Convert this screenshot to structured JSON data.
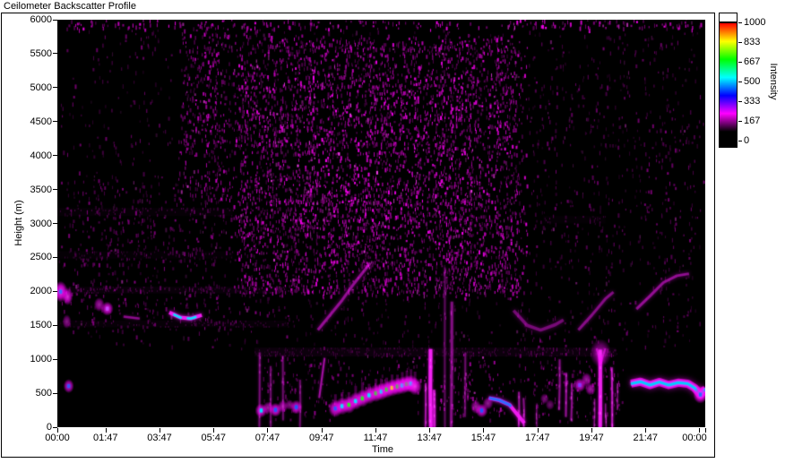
{
  "window": {
    "title": "Ceilometer Backscatter Profile"
  },
  "chart_data": {
    "type": "heatmap",
    "title": "Ceilometer Backscatter Profile",
    "xlabel": "Time",
    "ylabel": "Height (m)",
    "colorbar_label": "Intensity",
    "x_range_hours": [
      0,
      24
    ],
    "y_range_m": [
      0,
      6000
    ],
    "intensity_range": [
      0,
      1000
    ],
    "x_ticks": [
      [
        0,
        "00:00"
      ],
      [
        1.7833,
        "01:47"
      ],
      [
        3.7833,
        "03:47"
      ],
      [
        5.7833,
        "05:47"
      ],
      [
        7.7833,
        "07:47"
      ],
      [
        9.7833,
        "09:47"
      ],
      [
        11.7833,
        "11:47"
      ],
      [
        13.7833,
        "13:47"
      ],
      [
        15.7833,
        "15:47"
      ],
      [
        17.7833,
        "17:47"
      ],
      [
        19.7833,
        "19:47"
      ],
      [
        21.7833,
        "21:47"
      ],
      [
        23.7833,
        ""
      ],
      [
        24,
        "00:00"
      ]
    ],
    "y_tick_values": [
      0,
      500,
      1000,
      1500,
      2000,
      2500,
      3000,
      3500,
      4000,
      4500,
      5000,
      5500,
      6000
    ],
    "colorbar_ticks": [
      [
        1000,
        "1000"
      ],
      [
        833,
        "833"
      ],
      [
        667,
        "667"
      ],
      [
        500,
        "500"
      ],
      [
        333,
        "333"
      ],
      [
        167,
        "167"
      ],
      [
        0,
        "0"
      ]
    ],
    "colormap_stops": [
      [
        0.0,
        "#000000"
      ],
      [
        0.167,
        "#ff00ff"
      ],
      [
        0.333,
        "#0000ff"
      ],
      [
        0.5,
        "#00ffff"
      ],
      [
        0.667,
        "#00ff00"
      ],
      [
        0.833,
        "#ffff00"
      ],
      [
        1.0,
        "#ff0000"
      ]
    ],
    "over_range_color": "#ffffff",
    "background_color": "#000000",
    "speckle_color": "#ff00ff",
    "noise_regions": [
      [
        0,
        24,
        1150,
        6000,
        0.05,
        0.15,
        0.45
      ],
      [
        0,
        6.5,
        2300,
        3600,
        0.12,
        0.2,
        0.5
      ],
      [
        4.3,
        8,
        3300,
        6000,
        0.22,
        0.25,
        0.8
      ],
      [
        6.3,
        17.5,
        1900,
        5800,
        0.3,
        0.25,
        0.9
      ],
      [
        8.3,
        15.8,
        2600,
        5300,
        0.32,
        0.3,
        1.0
      ],
      [
        0,
        8.5,
        1400,
        2250,
        0.1,
        0.2,
        0.55
      ],
      [
        17.5,
        24,
        2300,
        5600,
        0.07,
        0.15,
        0.45
      ],
      [
        21.3,
        24,
        2800,
        4800,
        0.09,
        0.2,
        0.5
      ],
      [
        7.3,
        14,
        100,
        1150,
        0.1,
        0.2,
        0.6
      ],
      [
        13.9,
        16.6,
        100,
        1150,
        0.13,
        0.25,
        0.7
      ],
      [
        16.6,
        21,
        100,
        1450,
        0.1,
        0.2,
        0.6
      ],
      [
        0,
        24,
        5870,
        6000,
        0.6,
        0.35,
        1.0
      ]
    ],
    "bands": [
      [
        0,
        8.5,
        1970,
        2070,
        0.1
      ],
      [
        0,
        8.5,
        1470,
        1570,
        0.08
      ],
      [
        7.3,
        20.7,
        1040,
        1170,
        0.14
      ],
      [
        0,
        6.5,
        3110,
        3230,
        0.07
      ],
      [
        0,
        6.5,
        2480,
        2590,
        0.06
      ],
      [
        18,
        20.3,
        3000,
        3110,
        0.06
      ]
    ],
    "vertical_streaks": [
      [
        7.5,
        0,
        1100,
        2,
        0.35
      ],
      [
        7.9,
        0,
        900,
        2,
        0.3
      ],
      [
        8.35,
        100,
        1050,
        2,
        0.3
      ],
      [
        9.0,
        0,
        700,
        2,
        0.3
      ],
      [
        13.65,
        0,
        650,
        2,
        0.5
      ],
      [
        13.82,
        0,
        1150,
        4,
        0.85
      ],
      [
        13.97,
        0,
        550,
        3,
        0.6
      ],
      [
        14.35,
        0,
        2350,
        2,
        0.25
      ],
      [
        14.6,
        0,
        1850,
        3,
        0.35
      ],
      [
        15.1,
        150,
        1100,
        2,
        0.3
      ],
      [
        17.1,
        0,
        520,
        2,
        0.45
      ],
      [
        17.28,
        0,
        430,
        2,
        0.4
      ],
      [
        17.75,
        0,
        350,
        1.5,
        0.3
      ],
      [
        18.6,
        250,
        1000,
        2,
        0.4
      ],
      [
        18.85,
        150,
        800,
        2,
        0.45
      ],
      [
        19.05,
        100,
        650,
        2,
        0.4
      ],
      [
        19.9,
        0,
        420,
        1.5,
        0.4
      ],
      [
        20.12,
        0,
        1140,
        4,
        0.8
      ],
      [
        20.32,
        0,
        350,
        1.5,
        0.4
      ],
      [
        20.55,
        0,
        880,
        2,
        0.6
      ],
      [
        20.75,
        250,
        650,
        1.5,
        0.35
      ]
    ],
    "traces": [
      {
        "p": [
          [
            4.15,
            1690
          ],
          [
            4.55,
            1615
          ],
          [
            4.95,
            1600
          ],
          [
            5.35,
            1650
          ]
        ],
        "w": 4,
        "a": 0.9,
        "blur": 4,
        "core": {
          "c": "#00e8ff",
          "w": 2,
          "s": [
            [
              4.3,
              4.6
            ],
            [
              4.8,
              5.15
            ]
          ]
        }
      },
      {
        "p": [
          [
            2.45,
            1630
          ],
          [
            3.05,
            1600
          ]
        ],
        "w": 2.5,
        "a": 0.4,
        "blur": 3
      },
      {
        "p": [
          [
            9.65,
            1430
          ],
          [
            10.55,
            1870
          ],
          [
            11.0,
            2120
          ],
          [
            11.6,
            2420
          ]
        ],
        "w": 3,
        "a": 0.45,
        "blur": 4
      },
      {
        "p": [
          [
            9.7,
            430
          ],
          [
            9.9,
            1020
          ]
        ],
        "w": 2,
        "a": 0.5,
        "blur": 3
      },
      {
        "p": [
          [
            16.9,
            1720
          ],
          [
            17.4,
            1500
          ],
          [
            17.9,
            1430
          ],
          [
            18.45,
            1510
          ],
          [
            18.75,
            1580
          ]
        ],
        "w": 3.5,
        "a": 0.35,
        "blur": 5
      },
      {
        "p": [
          [
            19.3,
            1430
          ],
          [
            19.8,
            1650
          ],
          [
            20.3,
            1890
          ],
          [
            20.6,
            1990
          ]
        ],
        "w": 3,
        "a": 0.4,
        "blur": 4
      },
      {
        "p": [
          [
            21.45,
            1740
          ],
          [
            21.95,
            1930
          ],
          [
            22.45,
            2130
          ],
          [
            22.95,
            2230
          ],
          [
            23.4,
            2260
          ]
        ],
        "w": 3,
        "a": 0.45,
        "blur": 4
      },
      {
        "p": [
          [
            15.98,
            430
          ],
          [
            16.35,
            400
          ],
          [
            16.75,
            330
          ],
          [
            17.05,
            180
          ],
          [
            17.3,
            60
          ]
        ],
        "w": 4,
        "a": 0.85,
        "blur": 4,
        "core": {
          "c": "#2b6bff",
          "w": 2.5,
          "s": [
            [
              16.0,
              16.85
            ]
          ]
        }
      },
      {
        "p": [
          [
            19.98,
            1160
          ],
          [
            20.12,
            930
          ]
        ],
        "w": 2,
        "a": 0.45,
        "blur": 3
      },
      {
        "p": [
          [
            20.3,
            1160
          ],
          [
            20.12,
            930
          ]
        ],
        "w": 2,
        "a": 0.45,
        "blur": 3
      }
    ],
    "cloud_chain": {
      "erase_below_offset_m": 70,
      "nodes": [
        [
          10.3,
          275,
          "blue"
        ],
        [
          10.55,
          310,
          "cyan"
        ],
        [
          10.8,
          330,
          "green"
        ],
        [
          11.05,
          385,
          "cyan"
        ],
        [
          11.3,
          425,
          "green"
        ],
        [
          11.55,
          470,
          "cyan"
        ],
        [
          11.8,
          500,
          "green"
        ],
        [
          12.0,
          525,
          "cyan"
        ],
        [
          12.2,
          555,
          "green"
        ],
        [
          12.4,
          580,
          "yellow"
        ],
        [
          12.6,
          600,
          "green"
        ],
        [
          12.78,
          615,
          "cyan"
        ],
        [
          12.95,
          635,
          "green"
        ],
        [
          13.1,
          640,
          "cyan"
        ],
        [
          13.25,
          600,
          ""
        ]
      ]
    },
    "cloud_band": {
      "pts": [
        [
          21.25,
          640
        ],
        [
          21.6,
          670
        ],
        [
          21.95,
          620
        ],
        [
          22.3,
          665
        ],
        [
          22.65,
          620
        ],
        [
          23.0,
          655
        ],
        [
          23.35,
          640
        ],
        [
          23.6,
          580
        ],
        [
          23.82,
          480
        ],
        [
          23.95,
          540
        ],
        [
          24.02,
          560
        ]
      ],
      "bright_node": [
        23.82,
        480
      ]
    },
    "blobs": [
      [
        0.12,
        1995,
        4,
        6,
        0.95,
        "#4466ff"
      ],
      [
        0.38,
        1925,
        3,
        5,
        0.8,
        ""
      ],
      [
        0.35,
        1555,
        2.5,
        4,
        0.5,
        ""
      ],
      [
        0.42,
        605,
        3,
        4,
        0.75,
        "#3355ff"
      ],
      [
        1.55,
        1805,
        3,
        4,
        0.6,
        ""
      ],
      [
        1.85,
        1745,
        3.5,
        4,
        0.8,
        "#cc44ff"
      ],
      [
        7.55,
        245,
        3.5,
        4,
        0.8,
        "#00e0ff"
      ],
      [
        7.8,
        285,
        3,
        3.5,
        0.6,
        ""
      ],
      [
        8.08,
        255,
        3.5,
        4,
        0.85,
        "#2255ff"
      ],
      [
        8.35,
        305,
        3,
        3.5,
        0.6,
        ""
      ],
      [
        8.6,
        330,
        2.5,
        3,
        0.5,
        ""
      ],
      [
        8.85,
        295,
        3.5,
        4,
        0.8,
        "#2255ff"
      ],
      [
        15.5,
        300,
        3,
        4,
        0.6,
        ""
      ],
      [
        15.72,
        245,
        3.5,
        4,
        0.8,
        "#2255ff"
      ],
      [
        15.95,
        350,
        3,
        3.5,
        0.55,
        ""
      ],
      [
        18.05,
        420,
        2.5,
        3,
        0.45,
        ""
      ],
      [
        18.25,
        330,
        2.5,
        3,
        0.4,
        ""
      ],
      [
        19.35,
        620,
        3.5,
        4,
        0.75,
        "#8833ff"
      ],
      [
        19.6,
        700,
        3,
        4,
        0.6,
        ""
      ],
      [
        19.75,
        560,
        3,
        3.5,
        0.6,
        ""
      ],
      [
        20.12,
        1090,
        6,
        8,
        0.5,
        ""
      ]
    ]
  }
}
